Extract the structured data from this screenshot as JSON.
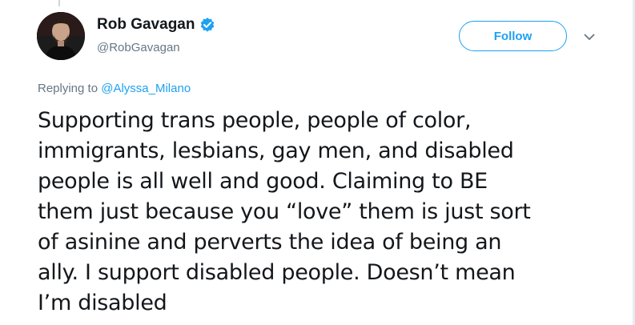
{
  "tweet": {
    "author": {
      "display_name": "Rob Gavagan",
      "handle": "@RobGavagan",
      "verified": true,
      "avatar_icon": "profile-photo"
    },
    "follow_label": "Follow",
    "more_icon": "chevron-down-icon",
    "reply_context": {
      "prefix": "Replying to",
      "target": "@Alyssa_Milano"
    },
    "text_lines": [
      "Supporting trans people, people of color,",
      "immigrants, lesbians, gay men, and disabled",
      "people is all well and good. Claiming to BE",
      "them just because you “love” them is just sort",
      "of asinine and perverts the idea of being an",
      "ally. I support disabled people. Doesn’t mean",
      "I’m disabled"
    ]
  },
  "colors": {
    "accent": "#1da1f2",
    "text_primary": "#14171a",
    "text_secondary": "#657786"
  }
}
